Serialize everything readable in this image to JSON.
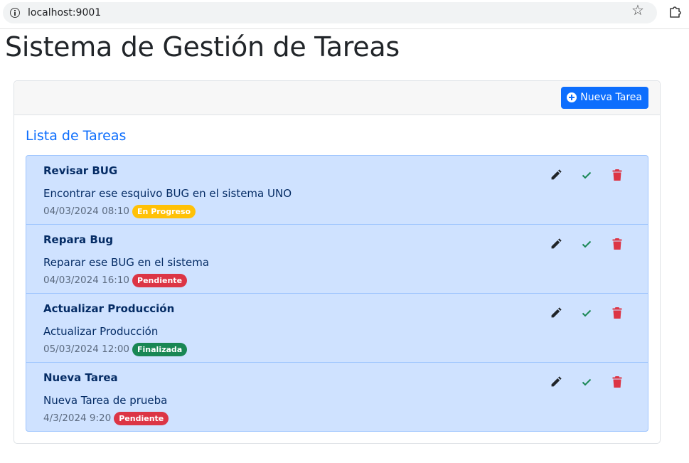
{
  "browser": {
    "url": "localhost:9001"
  },
  "page": {
    "title": "Sistema de Gestión de Tareas"
  },
  "toolbar": {
    "new_task_label": "Nueva Tarea"
  },
  "list": {
    "title": "Lista de Tareas",
    "tasks": [
      {
        "title": "Revisar BUG",
        "description": "Encontrar ese esquivo BUG en el sistema UNO",
        "date": "04/03/2024 08:10",
        "status": "En Progreso",
        "status_color": "#ffc107"
      },
      {
        "title": "Repara Bug",
        "description": "Reparar ese BUG en el sistema",
        "date": "04/03/2024 16:10",
        "status": "Pendiente",
        "status_color": "#dc3545"
      },
      {
        "title": "Actualizar Producción",
        "description": "Actualizar Producción",
        "date": "05/03/2024 12:00",
        "status": "Finalizada",
        "status_color": "#198754"
      },
      {
        "title": "Nueva Tarea",
        "description": "Nueva Tarea de prueba",
        "date": "4/3/2024 9:20",
        "status": "Pendiente",
        "status_color": "#dc3545"
      }
    ]
  },
  "icons": {
    "edit": "pencil-icon",
    "complete": "check-icon",
    "delete": "trash-icon"
  },
  "colors": {
    "primary": "#0d6efd",
    "list_bg": "#cfe2ff",
    "check": "#198754",
    "trash": "#dc3545",
    "pencil": "#212529"
  }
}
